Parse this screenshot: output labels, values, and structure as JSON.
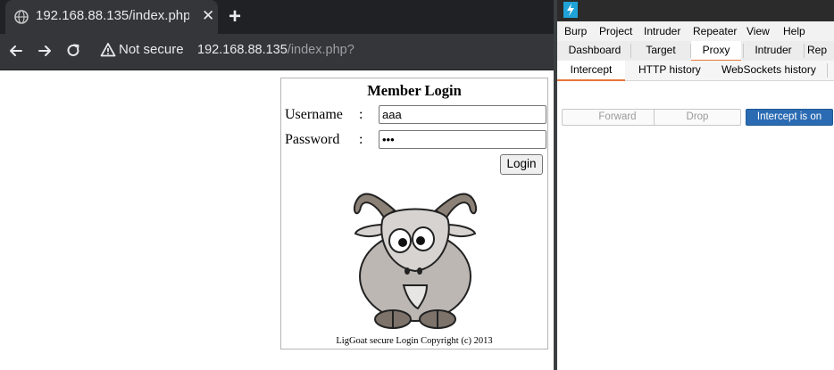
{
  "browser": {
    "tab_title": "192.168.88.135/index.php?",
    "tab_close": "✕",
    "new_tab": "+",
    "security_label": "Not secure",
    "url_host": "192.168.88.135",
    "url_path": "/index.php?"
  },
  "page": {
    "title": "Member Login",
    "username_label": "Username",
    "password_label": "Password",
    "colon": ":",
    "username_value": "aaa",
    "password_value": "•••",
    "login_button": "Login",
    "copyright": "LigGoat secure Login Copyright (c) 2013"
  },
  "burp": {
    "menu": [
      "Burp",
      "Project",
      "Intruder",
      "Repeater",
      "View",
      "Help"
    ],
    "tabs": [
      "Dashboard",
      "Target",
      "Proxy",
      "Intruder",
      "Rep"
    ],
    "active_tab": "Proxy",
    "subtabs": [
      "Intercept",
      "HTTP history",
      "WebSockets history"
    ],
    "active_subtab": "Intercept",
    "buttons": {
      "forward": "Forward",
      "drop": "Drop",
      "intercept": "Intercept is on"
    },
    "colors": {
      "accent": "#e8753a",
      "intercept_on": "#2a6bb3",
      "logo": "#1fa3d8"
    }
  }
}
